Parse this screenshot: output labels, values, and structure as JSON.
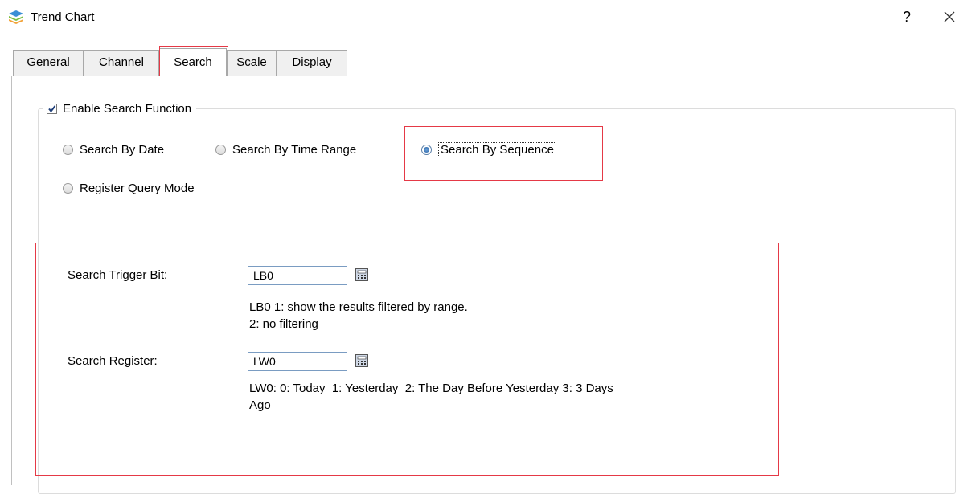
{
  "window": {
    "title": "Trend Chart",
    "help": "?",
    "close_icon": "close-icon",
    "app_icon": "trend-chart-app-icon"
  },
  "tabs": [
    {
      "label": "General",
      "active": false
    },
    {
      "label": "Channel",
      "active": false
    },
    {
      "label": "Search",
      "active": true
    },
    {
      "label": "Scale",
      "active": false
    },
    {
      "label": "Display",
      "active": false
    }
  ],
  "search_group": {
    "enable_label": "Enable Search Function",
    "enable_checked": true,
    "modes": [
      {
        "label": "Search By Date",
        "checked": false
      },
      {
        "label": "Search By Time Range",
        "checked": false
      },
      {
        "label": "Search By Sequence",
        "checked": true
      },
      {
        "label": "Register Query Mode",
        "checked": false
      }
    ]
  },
  "settings": {
    "trigger_label": "Search Trigger Bit:",
    "trigger_value": "LB0",
    "trigger_hint_line1": "LB0 1: show the results filtered by range.",
    "trigger_hint_line2": "2: no filtering",
    "register_label": "Search Register:",
    "register_value": "LW0",
    "register_hint_line1": "LW0: 0: Today  1: Yesterday  2: The Day Before Yesterday 3: 3 Days",
    "register_hint_line2": "Ago"
  },
  "colors": {
    "highlight": "#e53946",
    "input_border": "#7a9cc2",
    "radio_checked": "#2a5f9e"
  }
}
